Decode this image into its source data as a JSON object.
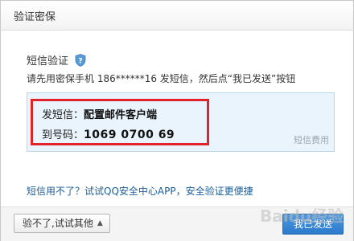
{
  "dialog": {
    "title": "验证密保"
  },
  "main": {
    "heading": "短信验证",
    "instruction": "请先用密保手机 186******16 发短信，然后点“我已发送”按钮",
    "sms_label": "发短信：",
    "sms_value": "配置邮件客户端",
    "number_label": "到号码：",
    "number_value": "1069 0700 69",
    "fee_note": "短信费用",
    "alt_link": "短信用不了？试试QQ安全中心APP，安全验证更便捷"
  },
  "footer": {
    "other_button": "验不了,试试其他",
    "sent_button": "我已发送"
  },
  "watermark": "Baidu经验",
  "colors": {
    "highlight": "#e2232a",
    "infobox_bg": "#eaf4fc",
    "primary": "#2b79cc",
    "link": "#1a5e99"
  },
  "icons": {
    "shield": "shield-question-icon",
    "caret": "caret-up-icon"
  }
}
